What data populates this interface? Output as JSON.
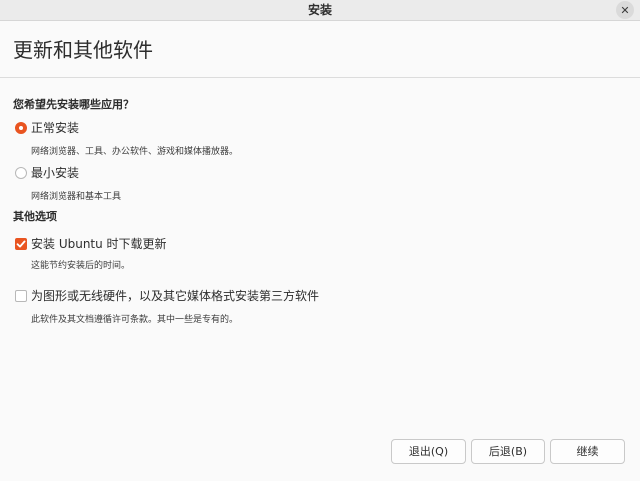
{
  "window": {
    "title": "安装",
    "close_symbol": "✕"
  },
  "header": {
    "title": "更新和其他软件"
  },
  "install_type": {
    "question": "您希望先安装哪些应用？",
    "normal": {
      "label": "正常安装",
      "description": "网络浏览器、工具、办公软件、游戏和媒体播放器。",
      "selected": true
    },
    "minimal": {
      "label": "最小安装",
      "description": "网络浏览器和基本工具",
      "selected": false
    }
  },
  "other_options": {
    "title": "其他选项",
    "download_updates": {
      "label": "安装 Ubuntu 时下载更新",
      "description": "这能节约安装后的时间。",
      "checked": true
    },
    "third_party": {
      "label": "为图形或无线硬件，以及其它媒体格式安装第三方软件",
      "description": "此软件及其文档遵循许可条款。其中一些是专有的。",
      "checked": false
    }
  },
  "buttons": {
    "quit": "退出(Q)",
    "back": "后退(B)",
    "continue": "继续"
  },
  "colors": {
    "accent": "#e95420"
  }
}
